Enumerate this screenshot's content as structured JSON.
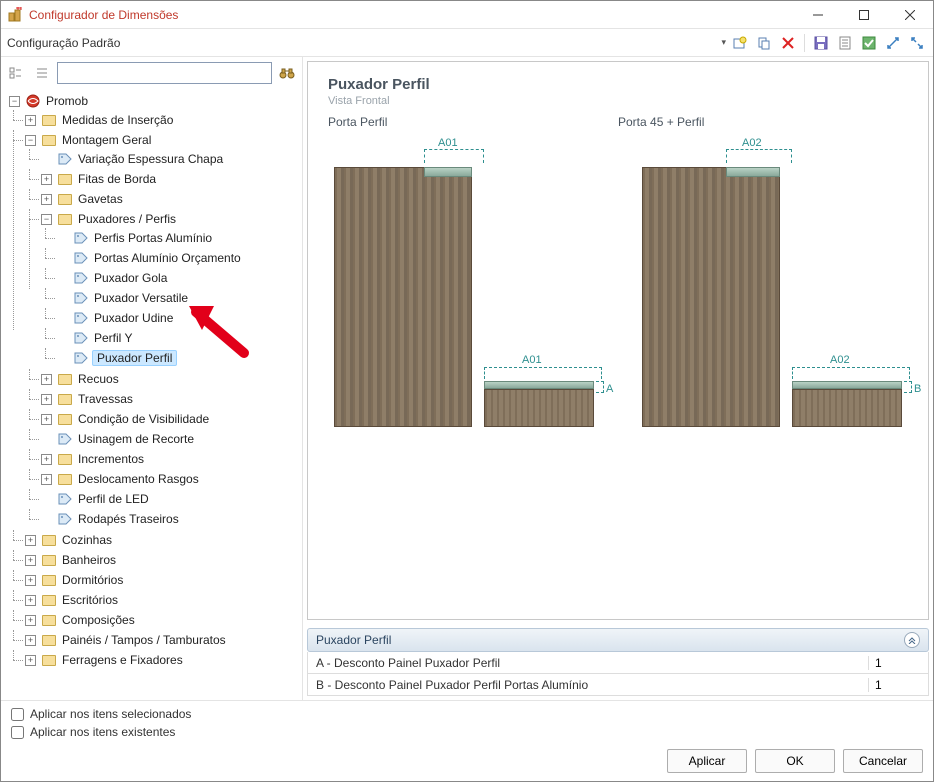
{
  "window": {
    "title": "Configurador de Dimensões"
  },
  "toolbar": {
    "config_label": "Configuração Padrão"
  },
  "search": {
    "placeholder": ""
  },
  "tree": {
    "root": {
      "label": "Promob",
      "children": [
        {
          "label": "Medidas de Inserção",
          "expander": "+",
          "icon": "folder"
        },
        {
          "label": "Montagem Geral",
          "expander": "−",
          "icon": "folder",
          "children": [
            {
              "label": "Variação Espessura Chapa",
              "icon": "tag"
            },
            {
              "label": "Fitas de Borda",
              "expander": "+",
              "icon": "folder"
            },
            {
              "label": "Gavetas",
              "expander": "+",
              "icon": "folder"
            },
            {
              "label": "Puxadores / Perfis",
              "expander": "−",
              "icon": "folder",
              "children": [
                {
                  "label": "Perfis Portas Alumínio",
                  "icon": "tag"
                },
                {
                  "label": "Portas Alumínio Orçamento",
                  "icon": "tag"
                },
                {
                  "label": "Puxador Gola",
                  "icon": "tag"
                },
                {
                  "label": "Puxador Versatile",
                  "icon": "tag"
                },
                {
                  "label": "Puxador Udine",
                  "icon": "tag"
                },
                {
                  "label": "Perfil Y",
                  "icon": "tag"
                },
                {
                  "label": "Puxador Perfil",
                  "icon": "tag",
                  "selected": true
                }
              ]
            },
            {
              "label": "Recuos",
              "expander": "+",
              "icon": "folder"
            },
            {
              "label": "Travessas",
              "expander": "+",
              "icon": "folder"
            },
            {
              "label": "Condição de Visibilidade",
              "expander": "+",
              "icon": "folder"
            },
            {
              "label": "Usinagem de Recorte",
              "icon": "tag"
            },
            {
              "label": "Incrementos",
              "expander": "+",
              "icon": "folder"
            },
            {
              "label": "Deslocamento Rasgos",
              "expander": "+",
              "icon": "folder"
            },
            {
              "label": "Perfil de LED",
              "icon": "tag"
            },
            {
              "label": "Rodapés Traseiros",
              "icon": "tag"
            }
          ]
        },
        {
          "label": "Cozinhas",
          "expander": "+",
          "icon": "folder"
        },
        {
          "label": "Banheiros",
          "expander": "+",
          "icon": "folder"
        },
        {
          "label": "Dormitórios",
          "expander": "+",
          "icon": "folder"
        },
        {
          "label": "Escritórios",
          "expander": "+",
          "icon": "folder"
        },
        {
          "label": "Composições",
          "expander": "+",
          "icon": "folder"
        },
        {
          "label": "Painéis / Tampos / Tamburatos",
          "expander": "+",
          "icon": "folder"
        },
        {
          "label": "Ferragens e  Fixadores",
          "expander": "+",
          "icon": "folder"
        }
      ]
    }
  },
  "preview": {
    "title": "Puxador Perfil",
    "subtitle": "Vista Frontal",
    "col1": "Porta Perfil",
    "col2": "Porta 45 + Perfil",
    "dims": {
      "a01": "A01",
      "a02": "A02",
      "a": "A",
      "b": "B"
    }
  },
  "params": {
    "header": "Puxador Perfil",
    "rows": [
      {
        "label": "A - Desconto Painel Puxador Perfil",
        "value": "1"
      },
      {
        "label": "B - Desconto Painel Puxador Perfil Portas Alumínio",
        "value": "1"
      }
    ]
  },
  "bottom": {
    "check_selected": "Aplicar nos itens selecionados",
    "check_existing": "Aplicar nos itens existentes"
  },
  "buttons": {
    "apply": "Aplicar",
    "ok": "OK",
    "cancel": "Cancelar"
  }
}
